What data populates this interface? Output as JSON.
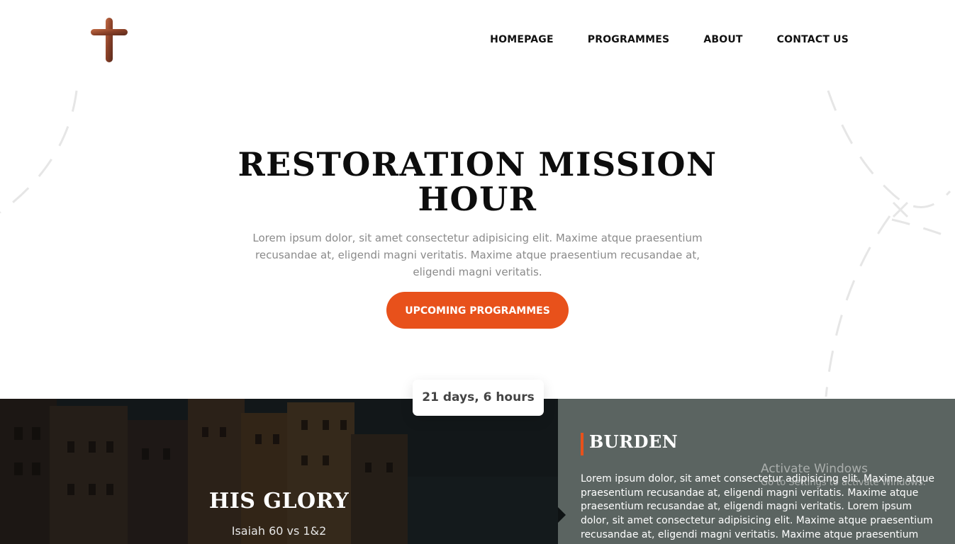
{
  "header": {
    "logo": "cross-logo",
    "nav": [
      "HOMEPAGE",
      "PROGRAMMES",
      "ABOUT",
      "CONTACT US"
    ]
  },
  "hero": {
    "title_line1": "RESTORATION MISSION",
    "title_line2": "HOUR",
    "description": "Lorem ipsum dolor, sit amet consectetur adipisicing elit. Maxime atque praesentium recusandae at, eligendi magni veritatis. Maxime atque praesentium recusandae at, eligendi magni veritatis.",
    "cta_label": "UPCOMING PROGRAMMES"
  },
  "countdown": "21 days, 6 hours",
  "glory": {
    "title": "HIS GLORY",
    "subtitle": "Isaiah 60 vs 1&2"
  },
  "burden": {
    "title": "BURDEN",
    "text": "Lorem ipsum dolor, sit amet consectetur adipisicing elit. Maxime atque praesentium recusandae at, eligendi magni veritatis. Maxime atque praesentium recusandae at, eligendi magni veritatis. Lorem ipsum dolor, sit amet consectetur adipisicing elit. Maxime atque praesentium recusandae at, eligendi magni veritatis. Maxime atque praesentium"
  },
  "watermark": {
    "line1": "Activate Windows",
    "line2": "Go to Settings to activate Windows."
  },
  "colors": {
    "accent": "#e8511b",
    "right_panel": "#5b6461",
    "title_text": "#0d0d0d",
    "muted_text": "#8a8a8a"
  }
}
